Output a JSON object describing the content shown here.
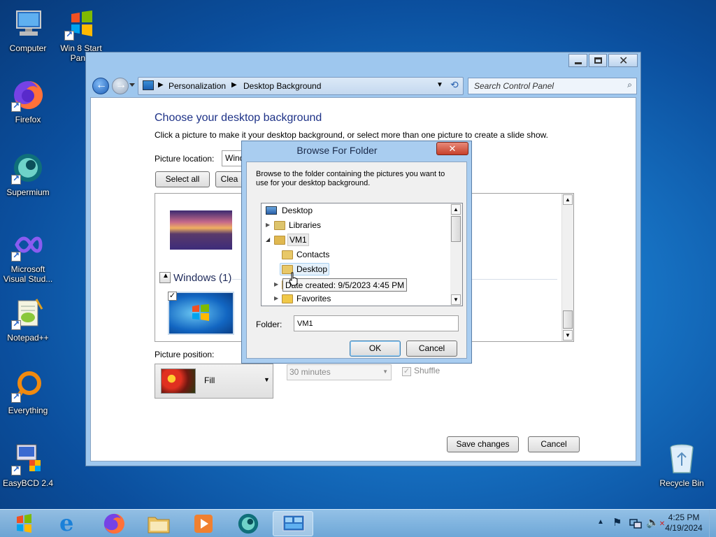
{
  "desktop": {
    "icons": [
      {
        "label": "Computer",
        "icon": "computer-icon"
      },
      {
        "label": "Win 8 Start Panel",
        "icon": "windows-logo-icon"
      },
      {
        "label": "Firefox",
        "icon": "firefox-icon"
      },
      {
        "label": "Supermium",
        "icon": "supermium-icon"
      },
      {
        "label": "Microsoft Visual Stud...",
        "icon": "visual-studio-icon"
      },
      {
        "label": "Notepad++",
        "icon": "notepad-plus-icon"
      },
      {
        "label": "Everything",
        "icon": "everything-search-icon"
      },
      {
        "label": "EasyBCD 2.4",
        "icon": "easybcd-icon"
      },
      {
        "label": "Recycle Bin",
        "icon": "recycle-bin-icon"
      }
    ]
  },
  "window": {
    "breadcrumb": [
      "Personalization",
      "Desktop Background"
    ],
    "search_placeholder": "Search Control Panel",
    "heading": "Choose your desktop background",
    "subheading": "Click a picture to make it your desktop background, or select more than one picture to create a slide show.",
    "picture_location_label": "Picture location:",
    "picture_location_value": "Wind",
    "select_all": "Select all",
    "clear_all": "Clea",
    "group_label": "Windows (1)",
    "picture_position_label": "Picture position:",
    "position_value": "Fill",
    "interval_value": "30 minutes",
    "shuffle_label": "Shuffle",
    "save_changes": "Save changes",
    "cancel": "Cancel"
  },
  "dialog": {
    "title": "Browse For Folder",
    "description": "Browse to the folder containing the pictures you want to use for your desktop background.",
    "tree": [
      {
        "label": "Desktop",
        "level": 0,
        "expander": "none"
      },
      {
        "label": "Libraries",
        "level": 1,
        "expander": "collapsed"
      },
      {
        "label": "VM1",
        "level": 1,
        "expander": "expanded"
      },
      {
        "label": "Contacts",
        "level": 2,
        "expander": "none"
      },
      {
        "label": "Desktop",
        "level": 2,
        "expander": "none"
      },
      {
        "label": "Do",
        "level": 2,
        "expander": "collapsed"
      },
      {
        "label": "Favorites",
        "level": 2,
        "expander": "collapsed"
      }
    ],
    "tooltip": "Date created: 9/5/2023 4:45 PM",
    "folder_label": "Folder:",
    "folder_value": "VM1",
    "ok": "OK",
    "cancel": "Cancel"
  },
  "taskbar": {
    "time": "4:25 PM",
    "date": "4/19/2024",
    "apps": [
      "start-orb",
      "internet-explorer",
      "firefox",
      "file-explorer",
      "media-player",
      "supermium",
      "control-panel"
    ]
  }
}
